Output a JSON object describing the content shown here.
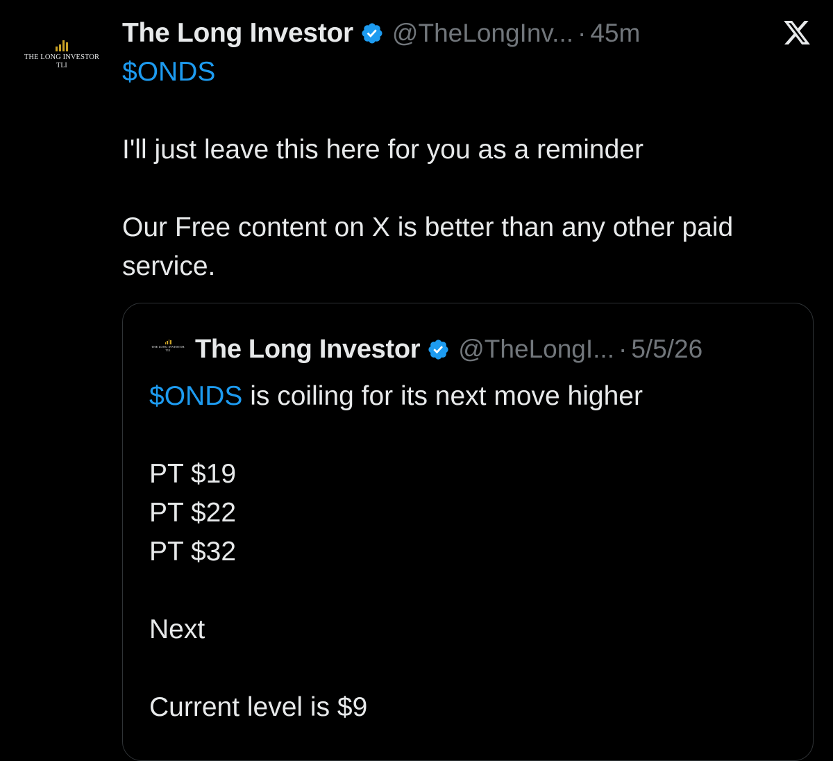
{
  "tweet": {
    "avatar": {
      "logo_name": "THE LONG INVESTOR",
      "logo_sub": "TLI"
    },
    "display_name": "The Long Investor",
    "handle": "@TheLongInv...",
    "separator": "·",
    "time": "45m",
    "cashtag": "$ONDS",
    "paragraphs": [
      "I'll just leave this here for you as a reminder",
      "Our Free content on X is better than any other paid service."
    ]
  },
  "quoted_tweet": {
    "avatar": {
      "logo_name": "THE LONG INVESTOR",
      "logo_sub": "TLI"
    },
    "display_name": "The Long Investor",
    "handle": "@TheLongI...",
    "separator": "·",
    "date": "5/5/26",
    "cashtag": "$ONDS",
    "first_line_rest": " is coiling for its next move higher",
    "price_targets": [
      "PT $19",
      "PT $22",
      "PT $32"
    ],
    "next_label": "Next",
    "current_level": "Current level is $9"
  },
  "icons": {
    "verified": "verified-badge-icon",
    "brand": "x-logo-icon"
  },
  "colors": {
    "background": "#000000",
    "text": "#e7e9ea",
    "muted": "#71767b",
    "accent": "#1d9bf0",
    "logo_gold": "#c9a227",
    "border": "#2f3336"
  }
}
